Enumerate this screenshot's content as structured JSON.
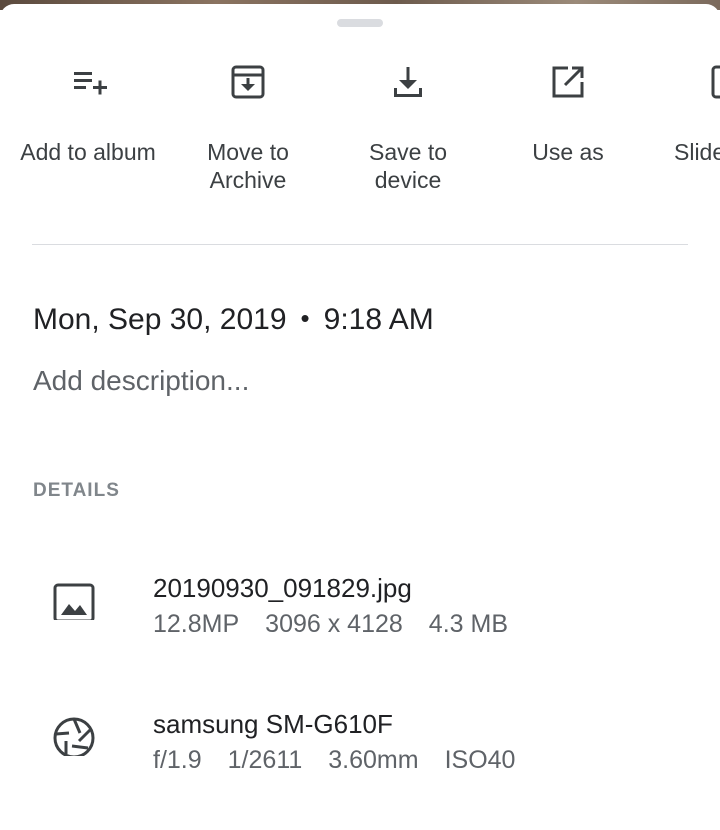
{
  "actions": [
    {
      "label": "Add to album",
      "icon": "playlist-add-icon"
    },
    {
      "label": "Move to\nArchive",
      "icon": "archive-icon"
    },
    {
      "label": "Save to\ndevice",
      "icon": "download-icon"
    },
    {
      "label": "Use as",
      "icon": "open-in-new-icon"
    },
    {
      "label": "Slide",
      "icon": "slideshow-icon"
    }
  ],
  "info": {
    "date": "Mon, Sep 30, 2019",
    "separator": "•",
    "time": "9:18 AM",
    "description_placeholder": "Add description..."
  },
  "details": {
    "header": "DETAILS",
    "file": {
      "icon": "image-icon",
      "name": "20190930_091829.jpg",
      "megapixels": "12.8MP",
      "resolution": "3096 x 4128",
      "size": "4.3 MB"
    },
    "camera": {
      "icon": "camera-shutter-icon",
      "model": "samsung SM-G610F",
      "aperture": "f/1.9",
      "shutter": "1/2611",
      "focal_length": "3.60mm",
      "iso": "ISO40"
    }
  },
  "colors": {
    "icon": "#3c4043",
    "text_primary": "#202124",
    "text_secondary": "#5f6368",
    "divider": "#dadce0"
  }
}
